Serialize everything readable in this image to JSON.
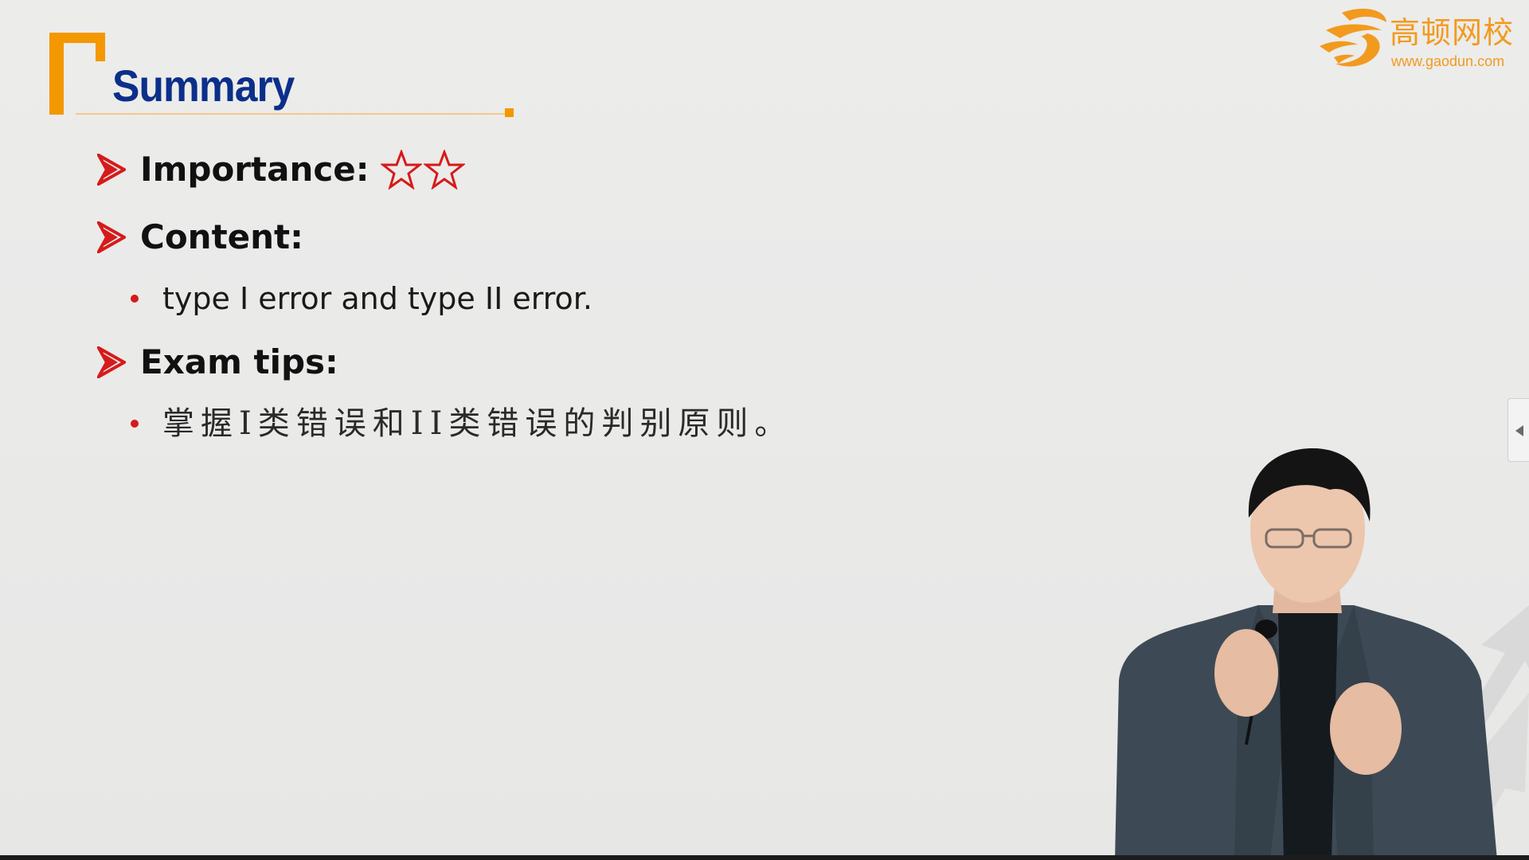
{
  "slide": {
    "title": "Summary",
    "items": [
      {
        "label": "Importance:",
        "stars": 2
      },
      {
        "label": "Content:"
      },
      {
        "label": "Exam tips:"
      }
    ],
    "sub_items": [
      "type I error and type II error.",
      "掌握I类错误和II类错误的判别原则。"
    ]
  },
  "logo": {
    "name": "高顿网校",
    "url": "www.gaodun.com"
  },
  "icons": {
    "item_marker": "arrowhead-icon",
    "rating": "star-outline-icon",
    "side_tab": "collapse-left-icon"
  },
  "colors": {
    "title": "#0b2f8a",
    "accent_orange": "#f39800",
    "marker_red": "#d61a1a",
    "background": "#e9e9e8"
  }
}
